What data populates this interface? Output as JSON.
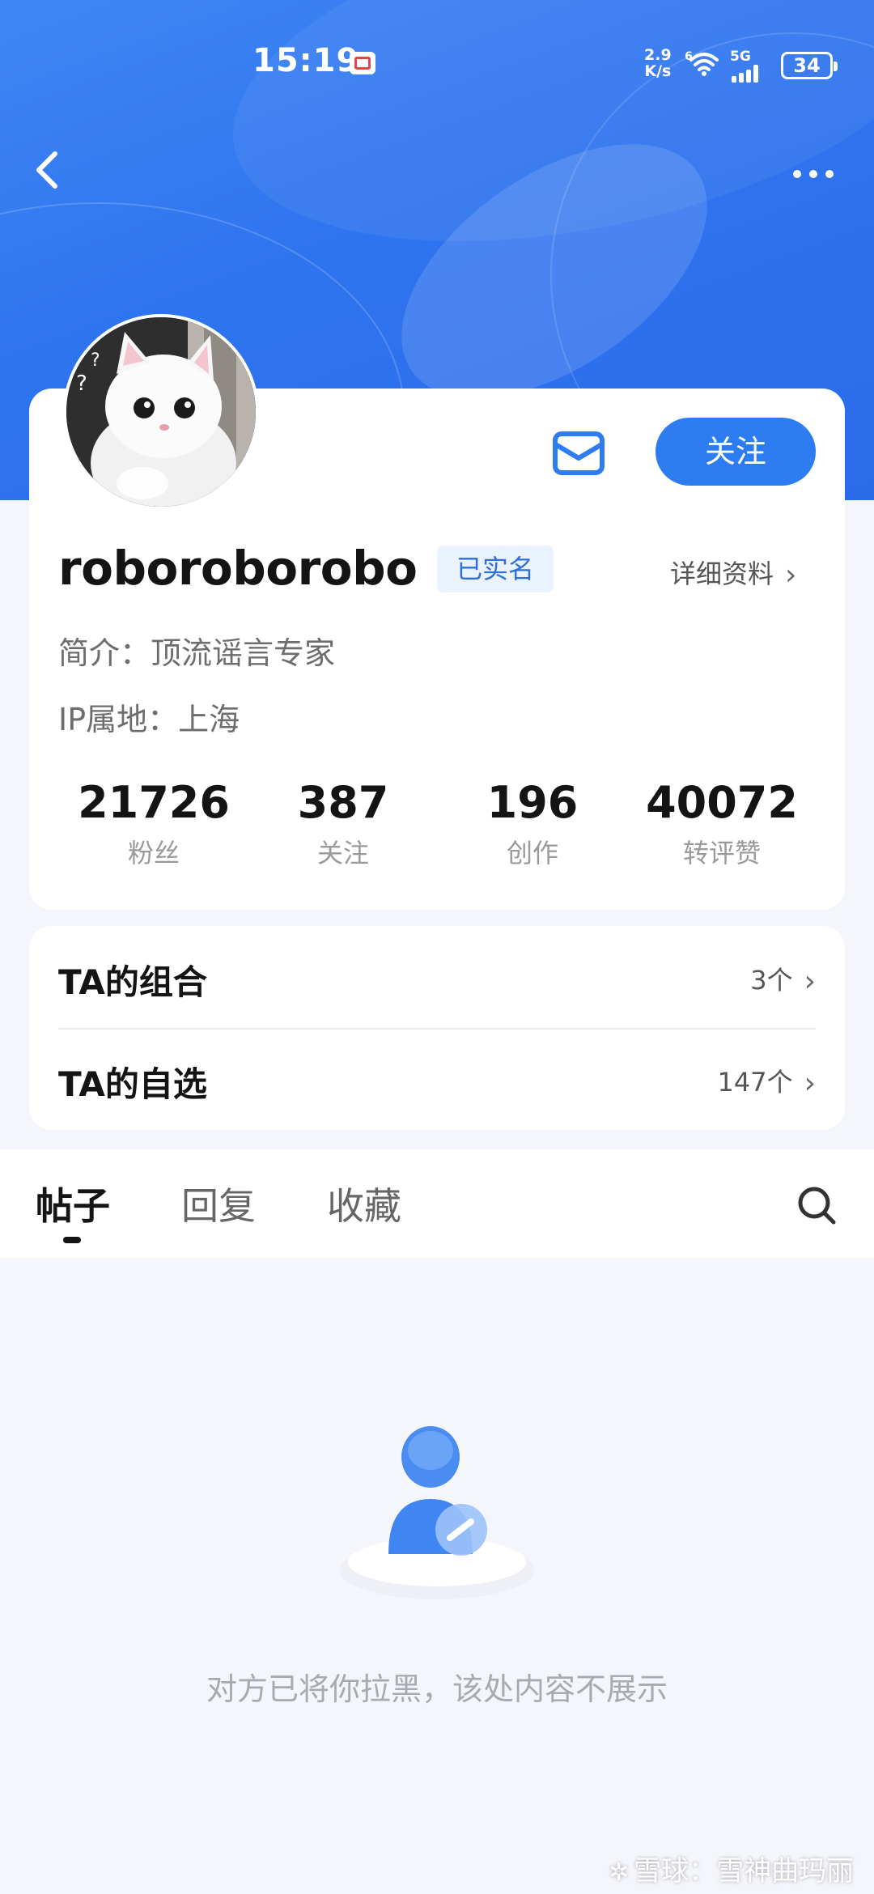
{
  "status_bar": {
    "time": "15:19",
    "net_rate_value": "2.9",
    "net_rate_unit": "K/s",
    "wifi_badge": "6",
    "cellular": "5G",
    "battery": "34"
  },
  "header": {
    "back_icon": "chevron-left-icon",
    "more_icon": "more-horizontal-icon"
  },
  "profile": {
    "avatar_alt": "white cat",
    "username": "roboroborobo",
    "verified_label": "已实名",
    "details_label": "详细资料",
    "bio": "简介：顶流谣言专家",
    "ip_location": "IP属地：上海",
    "follow_label": "关注",
    "message_icon": "envelope-icon",
    "stats": [
      {
        "value": "21726",
        "label": "粉丝"
      },
      {
        "value": "387",
        "label": "关注"
      },
      {
        "value": "196",
        "label": "创作"
      },
      {
        "value": "40072",
        "label": "转评赞"
      }
    ]
  },
  "lists": [
    {
      "title": "TA的组合",
      "count": "3个"
    },
    {
      "title": "TA的自选",
      "count": "147个"
    }
  ],
  "tabs": [
    {
      "label": "帖子",
      "active": true
    },
    {
      "label": "回复",
      "active": false
    },
    {
      "label": "收藏",
      "active": false
    }
  ],
  "empty_state": {
    "icon": "user-blocked-icon",
    "message": "对方已将你拉黑，该处内容不展示"
  },
  "watermark": {
    "text": "雪球：雪神曲玛丽"
  },
  "colors": {
    "header_blue": "#2f74ef",
    "accent": "#2d7cf2",
    "badge_bg": "#eaf2fd",
    "badge_text": "#2f6fd8",
    "page_bg": "#f4f6fb"
  }
}
